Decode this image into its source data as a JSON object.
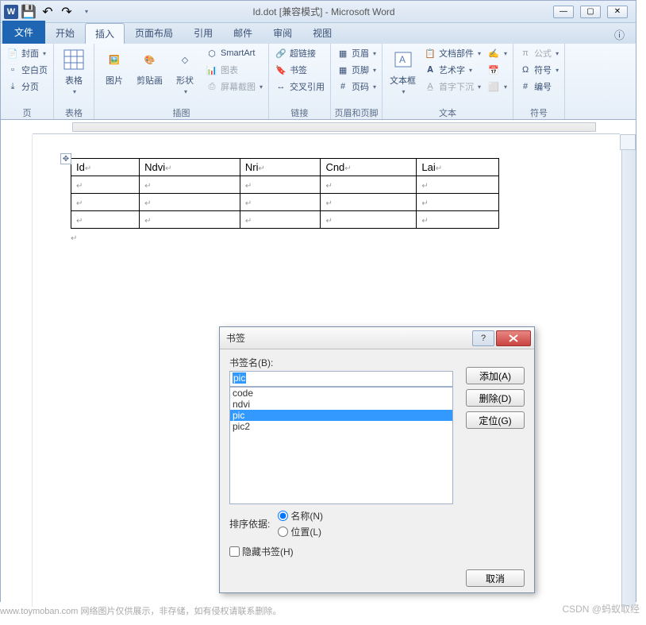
{
  "window": {
    "title": "Id.dot [兼容模式] - Microsoft Word"
  },
  "tabs": {
    "file": "文件",
    "home": "开始",
    "insert": "插入",
    "layout": "页面布局",
    "references": "引用",
    "mailings": "邮件",
    "review": "审阅",
    "view": "视图"
  },
  "ribbon": {
    "pages": {
      "cover": "封面",
      "blank": "空白页",
      "break": "分页",
      "group": "页"
    },
    "tables": {
      "table": "表格",
      "group": "表格"
    },
    "illus": {
      "picture": "图片",
      "clipart": "剪贴画",
      "shapes": "形状",
      "smartart": "SmartArt",
      "chart": "图表",
      "screenshot": "屏幕截图",
      "group": "插图"
    },
    "links": {
      "hyperlink": "超链接",
      "bookmark": "书签",
      "crossref": "交叉引用",
      "group": "链接"
    },
    "headerfooter": {
      "header": "页眉",
      "footer": "页脚",
      "pagenum": "页码",
      "group": "页眉和页脚"
    },
    "text": {
      "textbox": "文本框",
      "quickparts": "文档部件",
      "wordart": "艺术字",
      "dropcap": "首字下沉",
      "signature": "",
      "datetime": "",
      "object": "",
      "group": "文本"
    },
    "symbols": {
      "equation": "公式",
      "symbol": "符号",
      "number": "编号",
      "group": "符号"
    }
  },
  "table": {
    "headers": [
      "Id",
      "Ndvi",
      "Nri",
      "Cnd",
      "Lai"
    ]
  },
  "dialog": {
    "title": "书签",
    "name_label": "书签名(B):",
    "name_value": "pic",
    "items": [
      "code",
      "ndvi",
      "pic",
      "pic2"
    ],
    "selected": "pic",
    "btn_add": "添加(A)",
    "btn_delete": "删除(D)",
    "btn_goto": "定位(G)",
    "sort_label": "排序依据:",
    "sort_name": "名称(N)",
    "sort_loc": "位置(L)",
    "hide": "隐藏书签(H)",
    "btn_cancel": "取消"
  },
  "footer": {
    "left": "www.toymoban.com 网络图片仅供展示，非存储，如有侵权请联系删除。",
    "right": "CSDN @蚂蚁取经"
  }
}
